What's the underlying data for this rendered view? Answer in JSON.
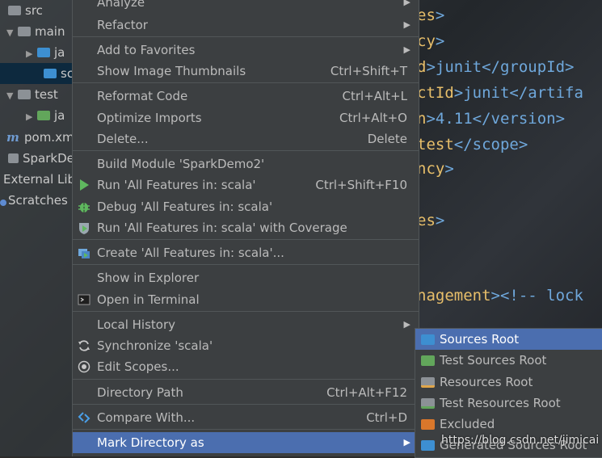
{
  "tree": {
    "items": [
      {
        "label": "src"
      },
      {
        "label": "main"
      },
      {
        "label": "ja"
      },
      {
        "label": "sc"
      },
      {
        "label": "test"
      },
      {
        "label": "ja"
      },
      {
        "label": "pom.xm"
      },
      {
        "label": "SparkDe"
      },
      {
        "label": "External Lib"
      },
      {
        "label": "Scratches a"
      }
    ]
  },
  "editor": {
    "lines": [
      {
        "a": "es",
        "b": ">"
      },
      {
        "a": "cy",
        "b": ">"
      },
      {
        "a": "d",
        "b": ">junit</groupId>"
      },
      {
        "a": "ctId",
        "b": ">junit</artifa"
      },
      {
        "a": "n",
        "b": ">4.11</version>"
      },
      {
        "a": "test",
        "b": "</scope>"
      },
      {
        "a": "ncy",
        "b": ">"
      },
      {
        "a": "es",
        "b": ">"
      },
      {
        "a": "nagement",
        "b": "><!-- lock"
      }
    ]
  },
  "menu": {
    "items": [
      {
        "label": "Analyze",
        "shortcut": ""
      },
      {
        "label": "Refactor",
        "shortcut": ""
      },
      {
        "label": "Add to Favorites",
        "shortcut": ""
      },
      {
        "label": "Show Image Thumbnails",
        "shortcut": "Ctrl+Shift+T"
      },
      {
        "label": "Reformat Code",
        "shortcut": "Ctrl+Alt+L"
      },
      {
        "label": "Optimize Imports",
        "shortcut": "Ctrl+Alt+O"
      },
      {
        "label": "Delete...",
        "shortcut": "Delete"
      },
      {
        "label": "Build Module 'SparkDemo2'",
        "shortcut": ""
      },
      {
        "label": "Run 'All Features in: scala'",
        "shortcut": "Ctrl+Shift+F10"
      },
      {
        "label": "Debug 'All Features in: scala'",
        "shortcut": ""
      },
      {
        "label": "Run 'All Features in: scala' with Coverage",
        "shortcut": ""
      },
      {
        "label": "Create 'All Features in: scala'...",
        "shortcut": ""
      },
      {
        "label": "Show in Explorer",
        "shortcut": ""
      },
      {
        "label": "Open in Terminal",
        "shortcut": ""
      },
      {
        "label": "Local History",
        "shortcut": ""
      },
      {
        "label": "Synchronize 'scala'",
        "shortcut": ""
      },
      {
        "label": "Edit Scopes...",
        "shortcut": ""
      },
      {
        "label": "Directory Path",
        "shortcut": "Ctrl+Alt+F12"
      },
      {
        "label": "Compare With...",
        "shortcut": "Ctrl+D"
      },
      {
        "label": "Mark Directory as",
        "shortcut": ""
      }
    ]
  },
  "submenu": {
    "items": [
      {
        "label": "Sources Root",
        "color": "#3d8fd1"
      },
      {
        "label": "Test Sources Root",
        "color": "#62a65b"
      },
      {
        "label": "Resources Root",
        "color": "#8c9196"
      },
      {
        "label": "Test Resources Root",
        "color": "#8c9196"
      },
      {
        "label": "Excluded",
        "color": "#d9772b"
      },
      {
        "label": "Generated Sources Root",
        "color": "#3d8fd1"
      }
    ]
  },
  "watermark": "https://blog.csdn.net/jimicai",
  "colors": {
    "highlight": "#4b6eaf",
    "menu_bg": "#3c3f41",
    "run_green": "#5fb85f"
  }
}
